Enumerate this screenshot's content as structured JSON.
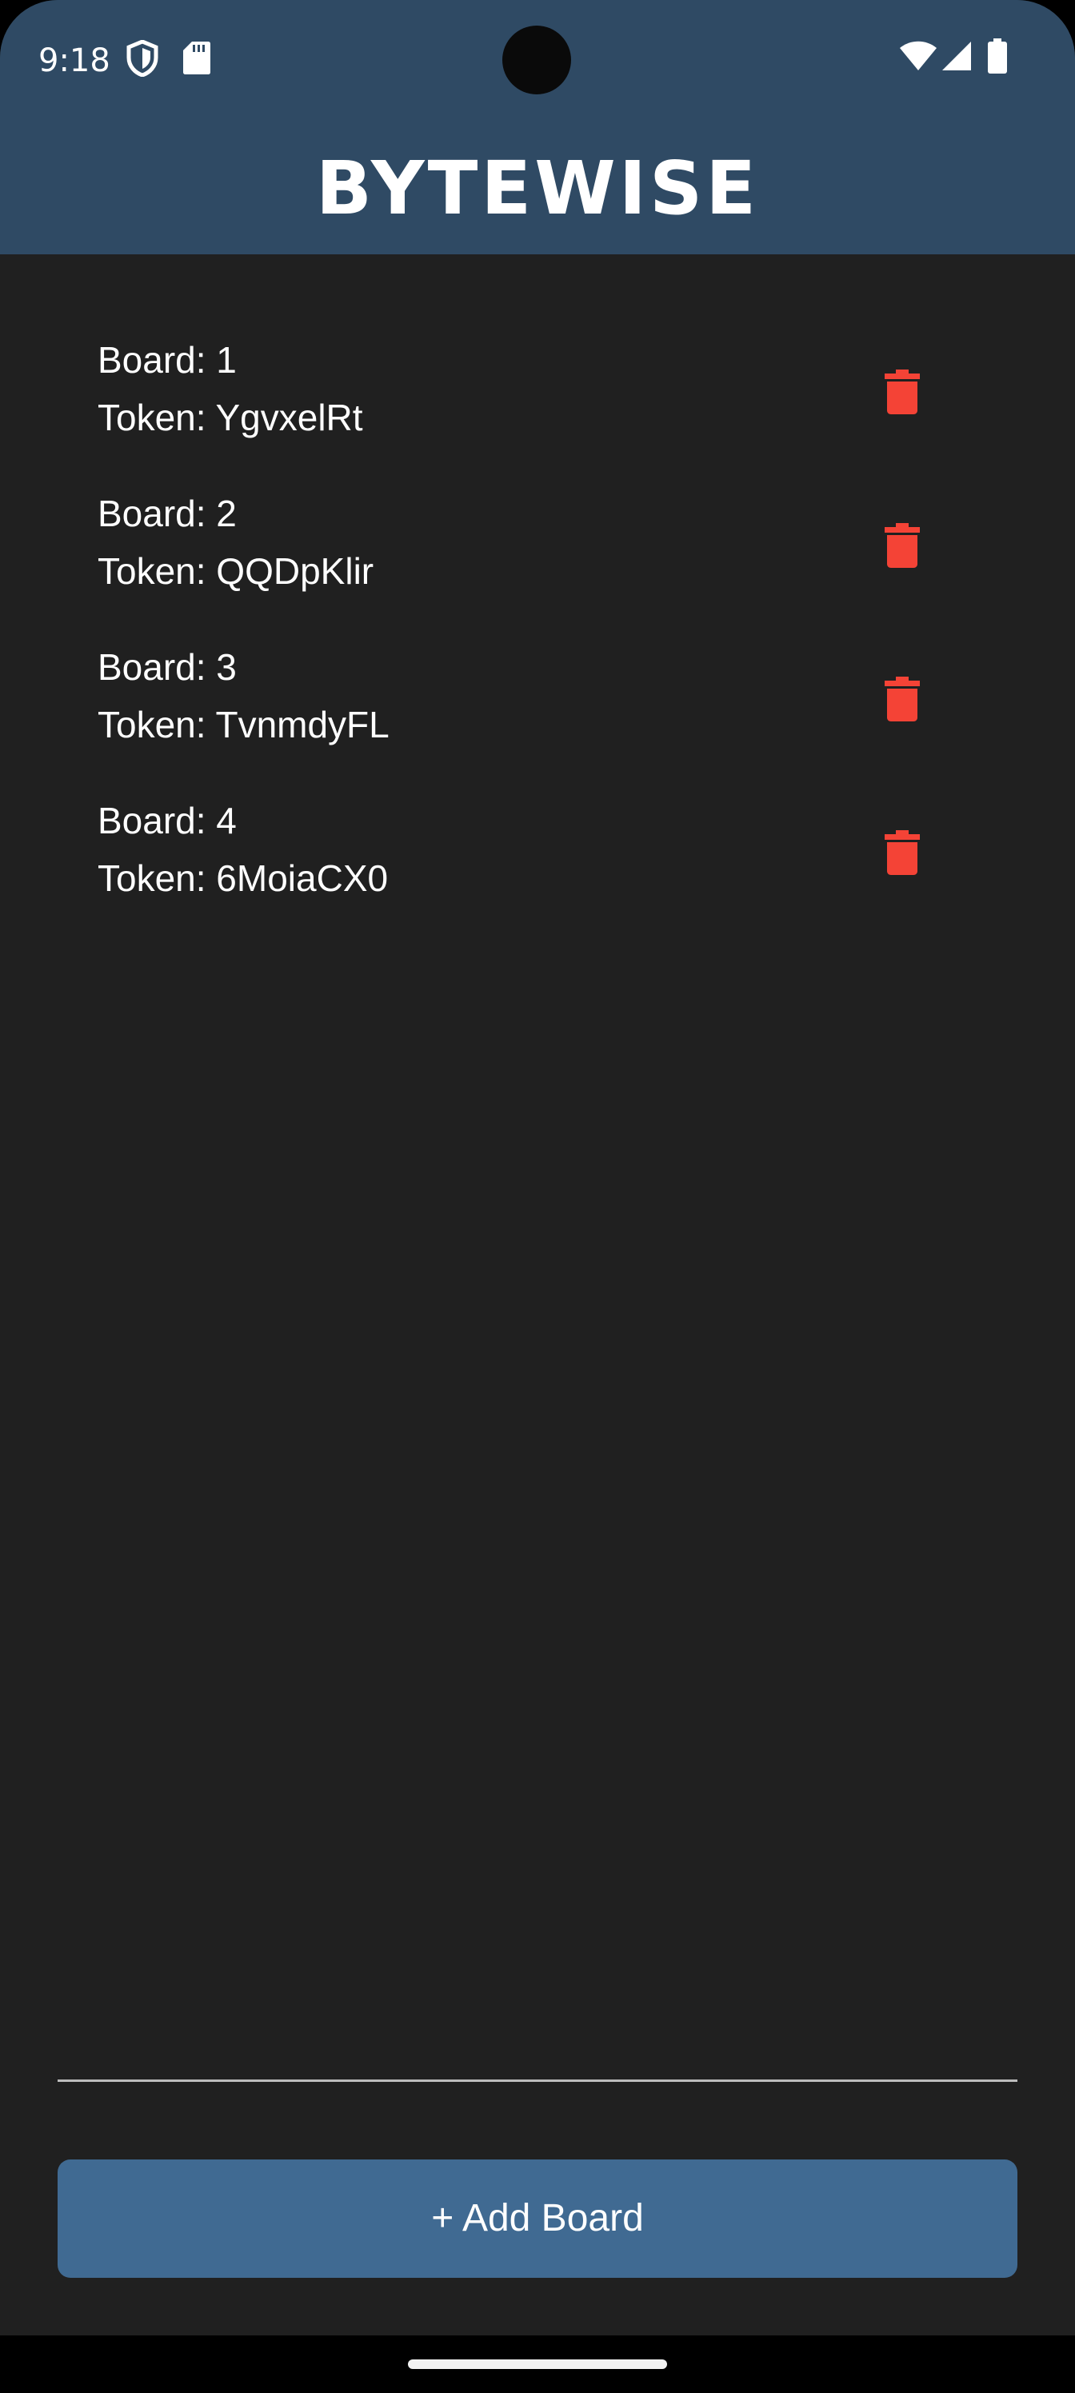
{
  "status_bar": {
    "time": "9:18",
    "left_icons": [
      "shield-icon",
      "sd-card-icon"
    ],
    "right_icons": [
      "wifi-icon",
      "cell-signal-icon",
      "battery-icon"
    ]
  },
  "app": {
    "title": "BYTEWISE",
    "header_color": "#2f4a64",
    "background_color": "#202020"
  },
  "boards": [
    {
      "board_label": "Board: 1",
      "token_label": "Token: YgvxelRt"
    },
    {
      "board_label": "Board: 2",
      "token_label": "Token: QQDpKlir"
    },
    {
      "board_label": "Board: 3",
      "token_label": "Token: TvnmdyFL"
    },
    {
      "board_label": "Board: 4",
      "token_label": "Token: 6MoiaCX0"
    }
  ],
  "delete_icon": {
    "name": "trash-icon",
    "color": "#f44336"
  },
  "add_button": {
    "label": "+ Add Board",
    "color": "#406a92"
  }
}
